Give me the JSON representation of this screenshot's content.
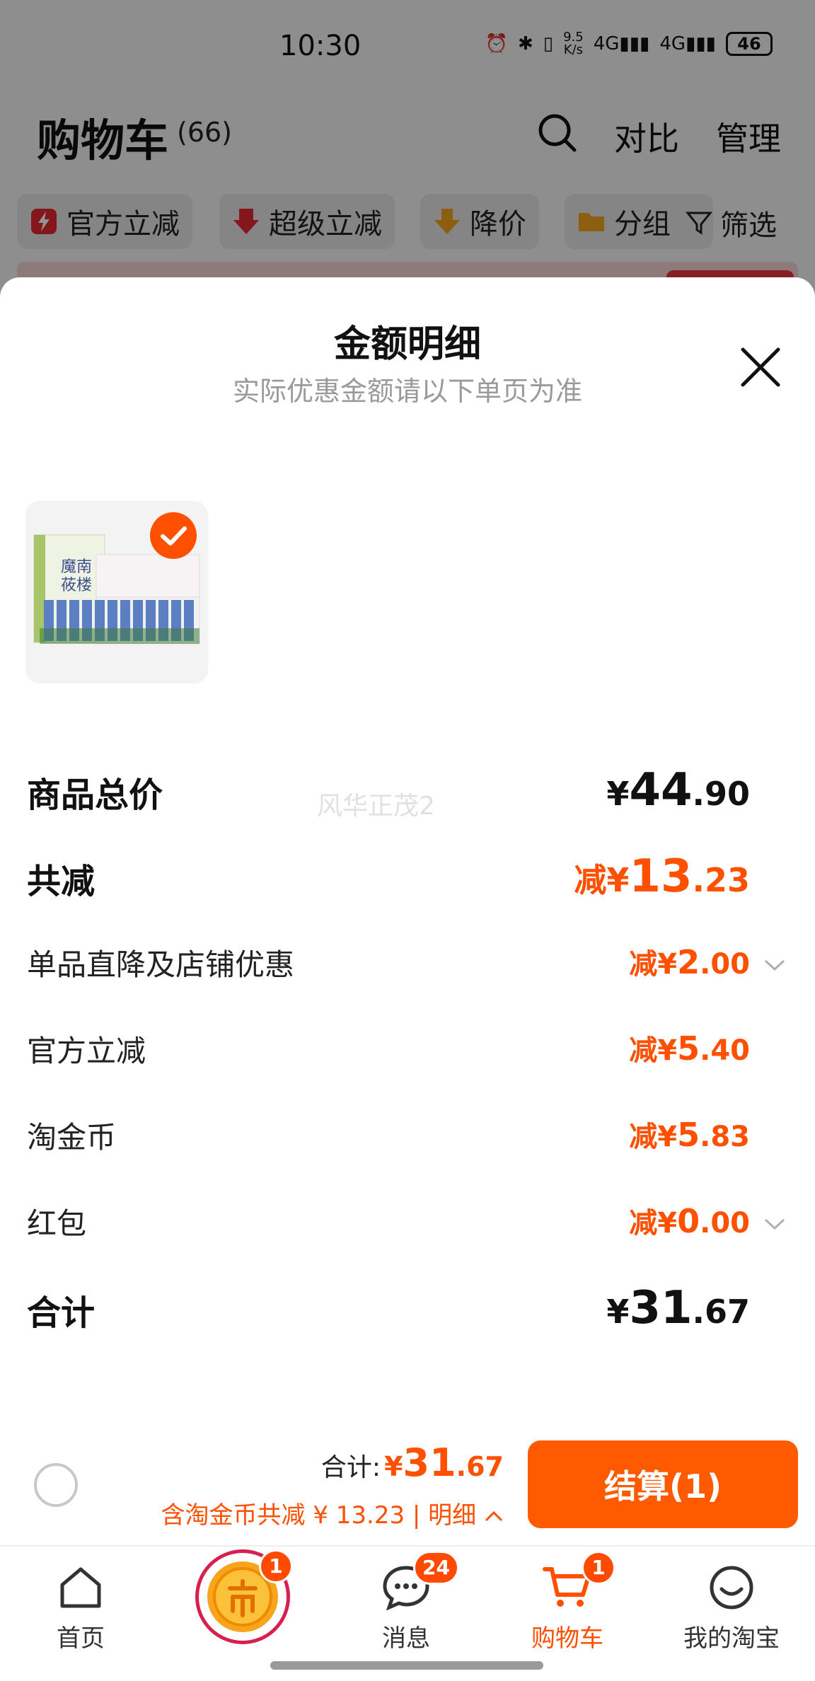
{
  "status_bar": {
    "time": "10:30",
    "net_speed_value": "9.5",
    "net_speed_unit": "K/s",
    "signal_1": "4G",
    "signal_2": "4G",
    "battery": "46"
  },
  "header": {
    "title": "购物车",
    "count": "(66)",
    "compare_label": "对比",
    "manage_label": "管理"
  },
  "filters": [
    {
      "label": "官方立减"
    },
    {
      "label": "超级立减"
    },
    {
      "label": "降价"
    },
    {
      "label": "分组"
    }
  ],
  "filter_button_label": "筛选",
  "sheet": {
    "title": "金额明细",
    "subtitle": "实际优惠金额请以下单页为准",
    "product_image_text_1": "魔南",
    "product_image_text_2": "莜楼",
    "watermark": "风华正茂2"
  },
  "rows": {
    "subtotal": {
      "label": "商品总价",
      "yen": "¥",
      "int": "44",
      "dec": ".90"
    },
    "total_reduce": {
      "label": "共减",
      "prefix": "减",
      "yen": "¥",
      "int": "13",
      "dec": ".23"
    },
    "item_discount": {
      "label": "单品直降及店铺优惠",
      "prefix": "减",
      "yen": "¥",
      "int": "2",
      "dec": ".00"
    },
    "official_reduce": {
      "label": "官方立减",
      "prefix": "减",
      "yen": "¥",
      "int": "5",
      "dec": ".40"
    },
    "gold_coin": {
      "label": "淘金币",
      "prefix": "减",
      "yen": "¥",
      "int": "5",
      "dec": ".83"
    },
    "red_packet": {
      "label": "红包",
      "prefix": "减",
      "yen": "¥",
      "int": "0",
      "dec": ".00"
    },
    "grand_total": {
      "label": "合计",
      "yen": "¥",
      "int": "31",
      "dec": ".67"
    }
  },
  "checkout": {
    "total_label": "合计:",
    "yen": "¥",
    "int": "31",
    "dec": ".67",
    "discount_note": "含淘金币共减 ¥ 13.23 | 明细",
    "button_label": "结算(1)"
  },
  "tabs": [
    {
      "label": "首页",
      "icon": "home-icon"
    },
    {
      "label": "",
      "icon": "coin-icon",
      "badge": "1"
    },
    {
      "label": "消息",
      "icon": "message-icon",
      "badge": "24"
    },
    {
      "label": "购物车",
      "icon": "cart-icon",
      "badge": "1",
      "active": true
    },
    {
      "label": "我的淘宝",
      "icon": "profile-icon"
    }
  ],
  "colors": {
    "accent": "#ff5000",
    "checkout_button": "#ff5a00",
    "badge": "#ff4a00",
    "coin_ring": "#d8204f"
  }
}
